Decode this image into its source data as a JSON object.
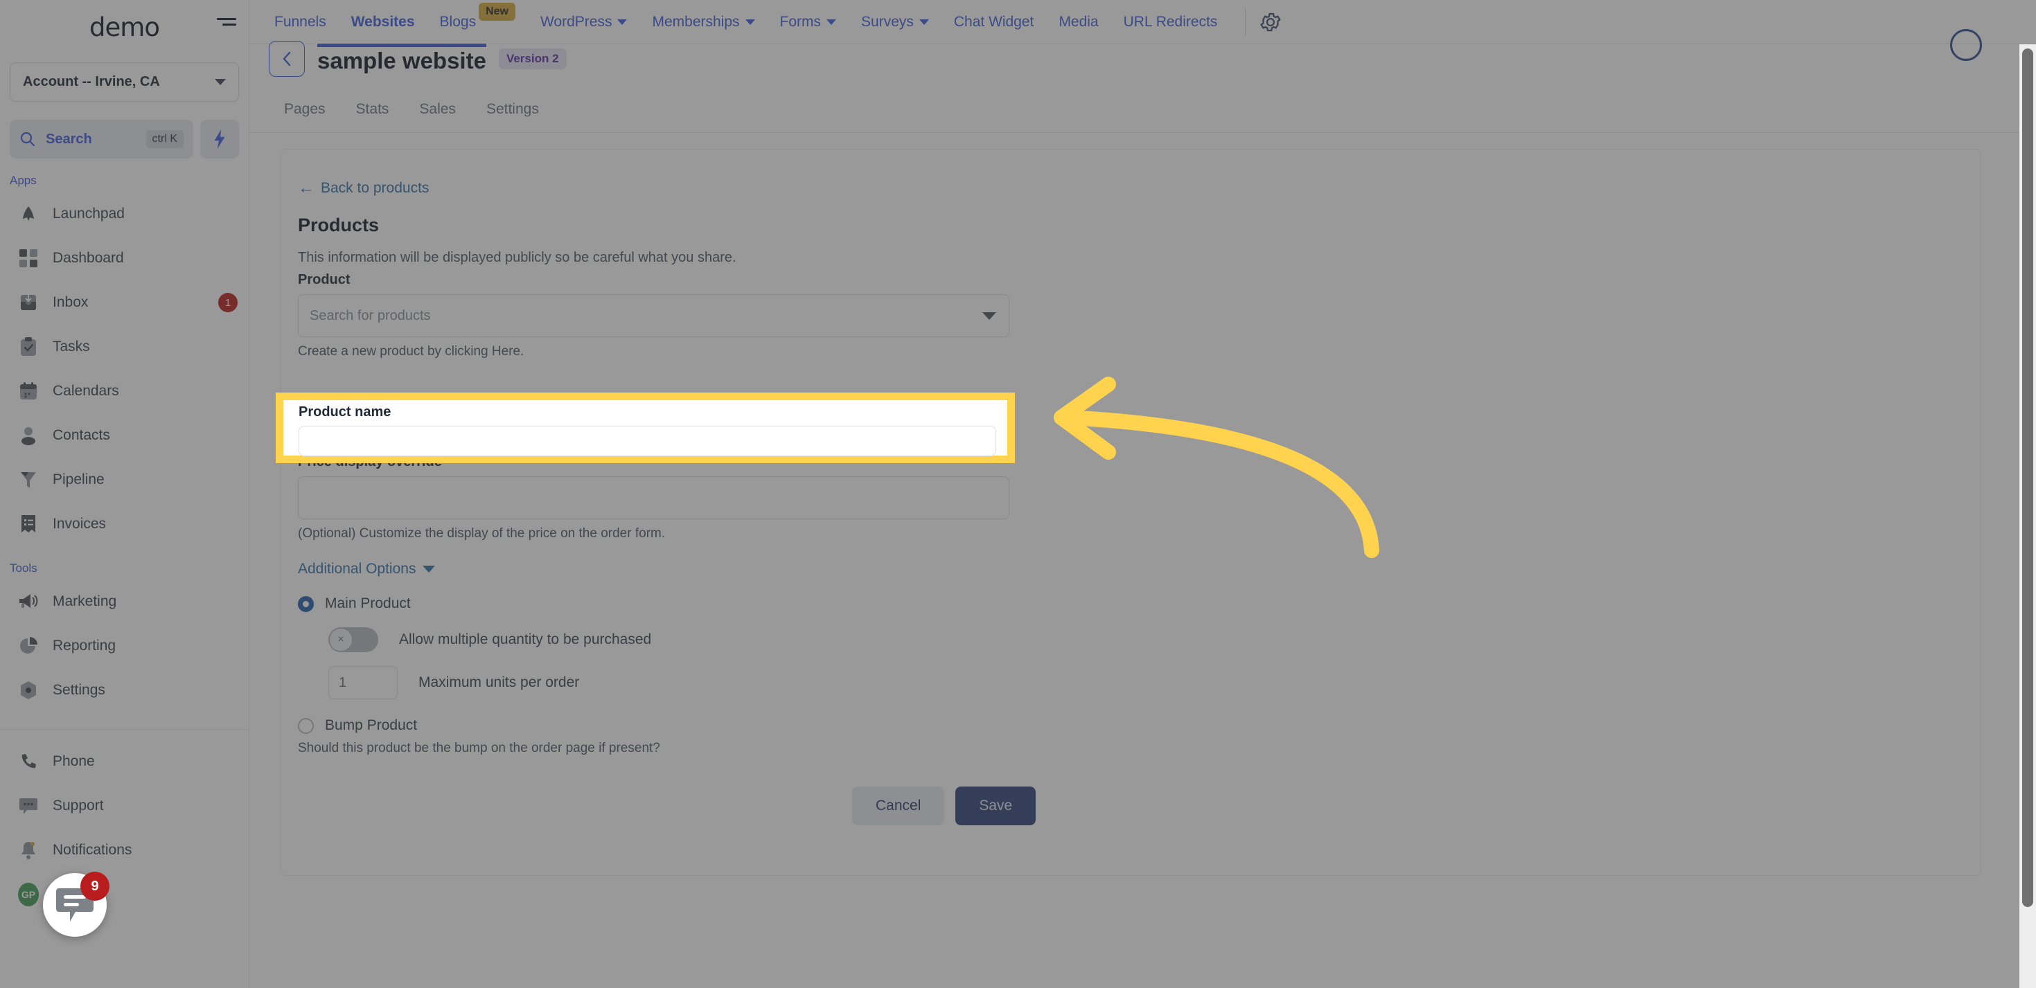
{
  "sidebar": {
    "logo": "demo",
    "account": {
      "label": "Account -- Irvine, CA",
      "caret_icon": "chevron-down-icon"
    },
    "search": {
      "label": "Search",
      "shortcut": "ctrl K",
      "icon": "search-icon"
    },
    "quick_action_icon": "lightning-bolt-icon",
    "groups": [
      {
        "title": "Apps",
        "items": [
          {
            "label": "Launchpad",
            "icon": "launchpad-icon",
            "badge": ""
          },
          {
            "label": "Dashboard",
            "icon": "dashboard-grid-icon",
            "badge": ""
          },
          {
            "label": "Inbox",
            "icon": "inbox-icon",
            "badge": "1"
          },
          {
            "label": "Tasks",
            "icon": "clipboard-check-icon",
            "badge": ""
          },
          {
            "label": "Calendars",
            "icon": "calendar-icon",
            "badge": ""
          },
          {
            "label": "Contacts",
            "icon": "person-icon",
            "badge": ""
          },
          {
            "label": "Pipeline",
            "icon": "funnel-icon",
            "badge": ""
          },
          {
            "label": "Invoices",
            "icon": "invoice-list-icon",
            "badge": ""
          }
        ]
      },
      {
        "title": "Tools",
        "items": [
          {
            "label": "Marketing",
            "icon": "megaphone-icon",
            "badge": ""
          },
          {
            "label": "Reporting",
            "icon": "pie-chart-icon",
            "badge": ""
          },
          {
            "label": "Settings",
            "icon": "gear-hex-icon",
            "badge": ""
          }
        ]
      }
    ],
    "footer_items": [
      {
        "label": "Phone",
        "icon": "phone-icon",
        "badge": ""
      },
      {
        "label": "Support",
        "icon": "chat-dots-icon",
        "badge": ""
      },
      {
        "label": "Notifications",
        "icon": "bell-icon",
        "badge": ""
      },
      {
        "label": "Profile",
        "icon": "avatar-icon",
        "badge": "",
        "avatar_initials": "GP"
      }
    ]
  },
  "chat_launcher": {
    "icon": "chat-bubble-icon",
    "badge": "9"
  },
  "topnav": {
    "items": [
      {
        "label": "Funnels",
        "caret": false,
        "active": false,
        "tag": ""
      },
      {
        "label": "Websites",
        "caret": false,
        "active": true,
        "tag": ""
      },
      {
        "label": "Blogs",
        "caret": false,
        "active": false,
        "tag": "New"
      },
      {
        "label": "WordPress",
        "caret": true,
        "active": false,
        "tag": ""
      },
      {
        "label": "Memberships",
        "caret": true,
        "active": false,
        "tag": ""
      },
      {
        "label": "Forms",
        "caret": true,
        "active": false,
        "tag": ""
      },
      {
        "label": "Surveys",
        "caret": true,
        "active": false,
        "tag": ""
      },
      {
        "label": "Chat Widget",
        "caret": false,
        "active": false,
        "tag": ""
      },
      {
        "label": "Media",
        "caret": false,
        "active": false,
        "tag": ""
      },
      {
        "label": "URL Redirects",
        "caret": false,
        "active": false,
        "tag": ""
      }
    ],
    "gear_icon": "gear-icon"
  },
  "page_header": {
    "back_icon": "back-arrow-icon",
    "title": "sample website",
    "version_badge": "Version 2",
    "right_icon": "help-circle-icon"
  },
  "subtabs": [
    {
      "label": "Pages",
      "active": true
    },
    {
      "label": "Stats",
      "active": false
    },
    {
      "label": "Sales",
      "active": false
    },
    {
      "label": "Settings",
      "active": false
    }
  ],
  "form": {
    "back_link": "Back to products",
    "back_link_icon": "arrow-left-icon",
    "section_title": "Products",
    "section_subtitle": "This information will be displayed publicly so be careful what you share.",
    "product_label": "Product",
    "product_placeholder": "Search for products",
    "product_value": "",
    "product_help": "Create a new product by clicking Here.",
    "product_name_label": "Product name",
    "product_name_value": "",
    "price_override_label": "Price display override",
    "price_override_value": "",
    "price_override_help": "(Optional) Customize the display of the price on the order form.",
    "additional_options_label": "Additional Options",
    "radio_main": "Main Product",
    "radio_main_selected": true,
    "toggle_allow_multiple_label": "Allow multiple quantity to be purchased",
    "toggle_allow_multiple_state": "off",
    "toggle_off_glyph": "×",
    "max_units_value": "1",
    "max_units_label": "Maximum units per order",
    "radio_bump": "Bump Product",
    "radio_bump_selected": false,
    "bump_help": "Should this product be the bump on the order page if present?",
    "cancel_label": "Cancel",
    "save_label": "Save"
  },
  "annotation": {
    "type": "curved-arrow-left",
    "color": "#ffd34e",
    "highlight_border_color": "#ffd34e",
    "target": "product-name-field"
  },
  "colors": {
    "accent_blue": "#3b5bdb",
    "link_blue": "#2c6fa8",
    "save_button": "#2e4279",
    "badge_red": "#b91c1c",
    "highlight_yellow": "#ffd34e",
    "dim_overlay": "rgba(60,60,60,0.52)"
  }
}
